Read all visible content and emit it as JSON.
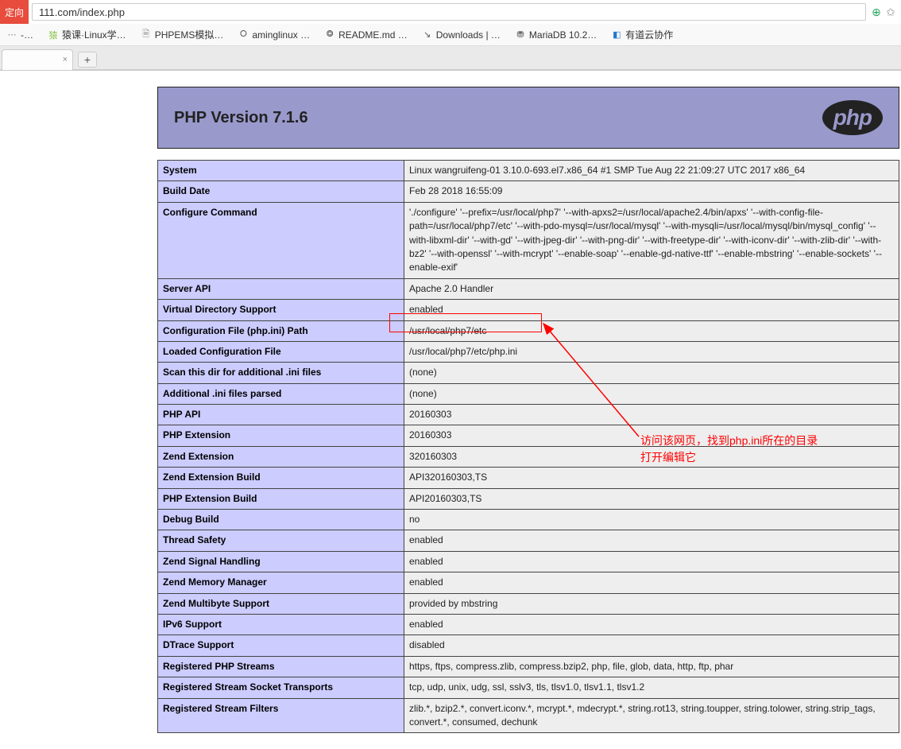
{
  "browser": {
    "redirect_label": "定向",
    "url": "111.com/index.php",
    "addr_icon": "⊕",
    "star": "✩"
  },
  "bookmarks": [
    {
      "icon": "⋯",
      "label": "-…",
      "color": "#888"
    },
    {
      "icon": "猿",
      "label": "猿课·Linux学…",
      "color": "#8bc34a"
    },
    {
      "icon": "🗎",
      "label": "PHPEMS模拟…",
      "color": "#888"
    },
    {
      "icon": "⭘",
      "label": "aminglinux …",
      "color": "#555"
    },
    {
      "icon": "⭗",
      "label": "README.md …",
      "color": "#555"
    },
    {
      "icon": "↘",
      "label": "Downloads | …",
      "color": "#555"
    },
    {
      "icon": "⛃",
      "label": "MariaDB 10.2…",
      "color": "#555"
    },
    {
      "icon": "◧",
      "label": "有道云协作",
      "color": "#2176d2"
    }
  ],
  "tab": {
    "title": ""
  },
  "phpinfo": {
    "title": "PHP Version 7.1.6",
    "logo": "php",
    "rows": [
      {
        "k": "System",
        "v": "Linux wangruifeng-01 3.10.0-693.el7.x86_64 #1 SMP Tue Aug 22 21:09:27 UTC 2017 x86_64"
      },
      {
        "k": "Build Date",
        "v": "Feb 28 2018 16:55:09"
      },
      {
        "k": "Configure Command",
        "v": "'./configure' '--prefix=/usr/local/php7' '--with-apxs2=/usr/local/apache2.4/bin/apxs' '--with-config-file-path=/usr/local/php7/etc' '--with-pdo-mysql=/usr/local/mysql' '--with-mysqli=/usr/local/mysql/bin/mysql_config' '--with-libxml-dir' '--with-gd' '--with-jpeg-dir' '--with-png-dir' '--with-freetype-dir' '--with-iconv-dir' '--with-zlib-dir' '--with-bz2' '--with-openssl' '--with-mcrypt' '--enable-soap' '--enable-gd-native-ttf' '--enable-mbstring' '--enable-sockets' '--enable-exif'"
      },
      {
        "k": "Server API",
        "v": "Apache 2.0 Handler"
      },
      {
        "k": "Virtual Directory Support",
        "v": "enabled"
      },
      {
        "k": "Configuration File (php.ini) Path",
        "v": "/usr/local/php7/etc"
      },
      {
        "k": "Loaded Configuration File",
        "v": "/usr/local/php7/etc/php.ini"
      },
      {
        "k": "Scan this dir for additional .ini files",
        "v": "(none)"
      },
      {
        "k": "Additional .ini files parsed",
        "v": "(none)"
      },
      {
        "k": "PHP API",
        "v": "20160303"
      },
      {
        "k": "PHP Extension",
        "v": "20160303"
      },
      {
        "k": "Zend Extension",
        "v": "320160303"
      },
      {
        "k": "Zend Extension Build",
        "v": "API320160303,TS"
      },
      {
        "k": "PHP Extension Build",
        "v": "API20160303,TS"
      },
      {
        "k": "Debug Build",
        "v": "no"
      },
      {
        "k": "Thread Safety",
        "v": "enabled"
      },
      {
        "k": "Zend Signal Handling",
        "v": "enabled"
      },
      {
        "k": "Zend Memory Manager",
        "v": "enabled"
      },
      {
        "k": "Zend Multibyte Support",
        "v": "provided by mbstring"
      },
      {
        "k": "IPv6 Support",
        "v": "enabled"
      },
      {
        "k": "DTrace Support",
        "v": "disabled"
      },
      {
        "k": "Registered PHP Streams",
        "v": "https, ftps, compress.zlib, compress.bzip2, php, file, glob, data, http, ftp, phar"
      },
      {
        "k": "Registered Stream Socket Transports",
        "v": "tcp, udp, unix, udg, ssl, sslv3, tls, tlsv1.0, tlsv1.1, tlsv1.2"
      },
      {
        "k": "Registered Stream Filters",
        "v": "zlib.*, bzip2.*, convert.iconv.*, mcrypt.*, mdecrypt.*, string.rot13, string.toupper, string.tolower, string.strip_tags, convert.*, consumed, dechunk"
      }
    ]
  },
  "annotation": {
    "line1": "访问该网页，找到php.ini所在的目录",
    "line2": "打开编辑它"
  }
}
